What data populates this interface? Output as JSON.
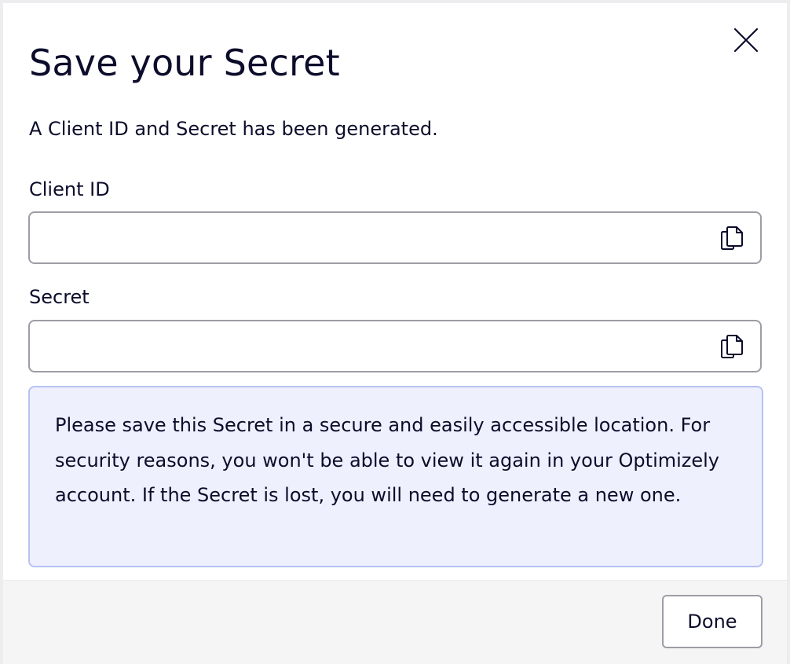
{
  "dialog": {
    "title": "Save your Secret",
    "subtitle": "A Client ID and Secret has been generated.",
    "close_icon": "close-icon"
  },
  "fields": {
    "client_id": {
      "label": "Client ID",
      "value": "",
      "icon": "copy-icon"
    },
    "secret": {
      "label": "Secret",
      "value": "",
      "icon": "copy-icon"
    }
  },
  "notice": {
    "text": "Please save this Secret in a secure and easily accessible location. For security reasons, you won't be able to view it again in your Optimizely account. If the Secret is lost, you will need to generate a new one."
  },
  "footer": {
    "done_label": "Done"
  },
  "colors": {
    "text": "#0c0c2b",
    "border": "#9d9da6",
    "notice_bg": "#eef0fd",
    "notice_border": "#b7c2f4",
    "footer_bg": "#f5f5f5"
  }
}
